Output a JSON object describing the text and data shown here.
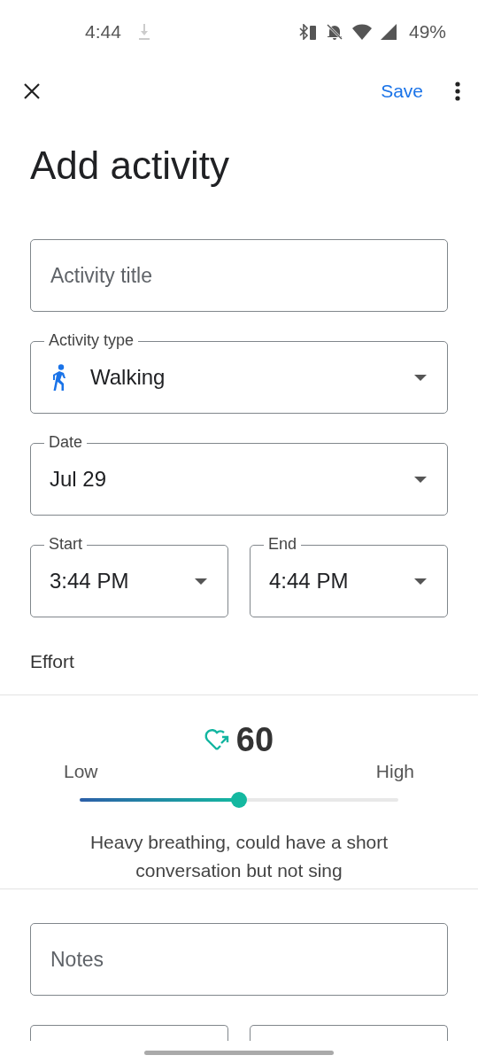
{
  "status_bar": {
    "time": "4:44",
    "battery": "49%"
  },
  "toolbar": {
    "save": "Save"
  },
  "title": "Add activity",
  "fields": [
    {
      "kind": "text",
      "placeholder": "Activity title"
    },
    {
      "kind": "icon_select",
      "label": "Activity type",
      "value": "Walking"
    },
    {
      "kind": "select",
      "label": "Date",
      "value": "Jul 29"
    }
  ],
  "time_fields": [
    {
      "label": "Start",
      "value": "3:44 PM"
    },
    {
      "label": "End",
      "value": "4:44 PM"
    }
  ],
  "effort": {
    "label": "Effort",
    "score": "60",
    "low": "Low",
    "high": "High",
    "level": 0.5,
    "description": "Heavy breathing, could have a short conversation but not sing"
  },
  "notes": {
    "placeholder": "Notes"
  }
}
